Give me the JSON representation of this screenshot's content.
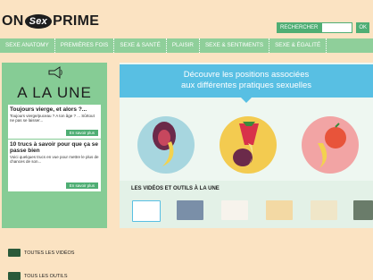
{
  "logo": {
    "left": "ON",
    "badge": "Sex",
    "right": "PRIME"
  },
  "search": {
    "label": "RECHERCHER",
    "button": "OK"
  },
  "nav": {
    "items": [
      "SEXE ANATOMY",
      "PREMIÈRES FOIS",
      "SEXE & SANTÉ",
      "PLAISIR",
      "SEXE & SENTIMENTS",
      "SEXE & ÉGALITÉ"
    ]
  },
  "sidebar": {
    "heading": "A LA UNE",
    "articles": [
      {
        "title": "Toujours vierge, et alors ?...",
        "text": "Toujours vierge/puceau ? A ton âge ? ... Sûrtout ne pas se laisser...",
        "button": "En savoir plus"
      },
      {
        "title": "10 trucs à savoir pour que ça se passe bien",
        "text": "Voici quelques trucs en vue pour mettre le plus de chances de son...",
        "button": "En savoir plus"
      }
    ],
    "links": [
      {
        "label": "TOUTES LES VIDÉOS",
        "icon": "video-icon"
      },
      {
        "label": "TOUS LES OUTILS",
        "icon": "tools-icon"
      }
    ]
  },
  "main": {
    "banner": {
      "line1": "Découvre les positions associées",
      "line2": "aux différentes pratiques sexuelles"
    },
    "videos_title": "LES VIDÉOS ET OUTILS À LA UNE"
  },
  "colors": {
    "accent_green": "#4fae74",
    "nav_green": "#8fcf9a",
    "banner_blue": "#58bfe3",
    "background": "#fbe3c2"
  }
}
